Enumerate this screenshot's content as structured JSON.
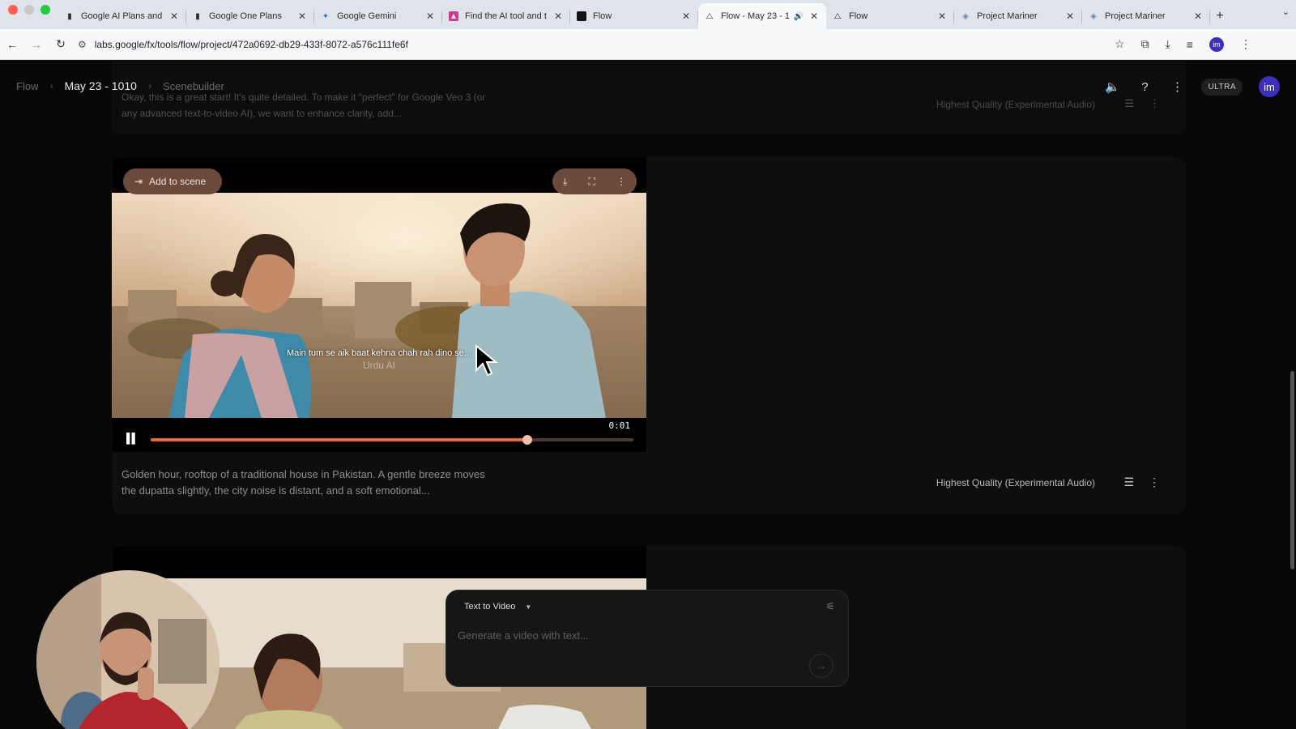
{
  "browser": {
    "tabs": [
      {
        "title": "Google AI Plans and"
      },
      {
        "title": "Google One Plans"
      },
      {
        "title": "Google Gemini"
      },
      {
        "title": "Find the AI tool and t"
      },
      {
        "title": "Flow"
      },
      {
        "title": "Flow - May 23 - 1"
      },
      {
        "title": "Flow"
      },
      {
        "title": "Project Mariner"
      },
      {
        "title": "Project Mariner"
      }
    ],
    "url": "labs.google/fx/tools/flow/project/472a0692-db29-433f-8072-a576c111fe6f"
  },
  "breadcrumb": {
    "root": "Flow",
    "project": "May 23 - 1010",
    "view": "Scenebuilder"
  },
  "header": {
    "badge": "ULTRA",
    "avatar": "im"
  },
  "top_card": {
    "prompt": "Okay, this is a great start! It's quite detailed. To make it \"perfect\" for Google Veo 3 (or any advanced text-to-video AI), we want to enhance clarity, add...",
    "quality": "Highest Quality (Experimental Audio)"
  },
  "main_card": {
    "add_to_scene": "Add to scene",
    "subtitle": "Main tum se aik baat kehna chah rah dino se...",
    "watermark": "Urdu AI",
    "time": "0:01",
    "progress": 0.78,
    "prompt": "Golden hour, rooftop of a traditional house in Pakistan. A gentle breeze moves the dupatta slightly, the city noise is distant, and a soft emotional...",
    "quality": "Highest Quality (Experimental Audio)"
  },
  "composer": {
    "mode": "Text to Video",
    "placeholder": "Generate a video with text..."
  },
  "colors": {
    "accent": "#e36d3b",
    "button_bg": "#6b4a3c",
    "avatar": "#3d2fb8"
  }
}
